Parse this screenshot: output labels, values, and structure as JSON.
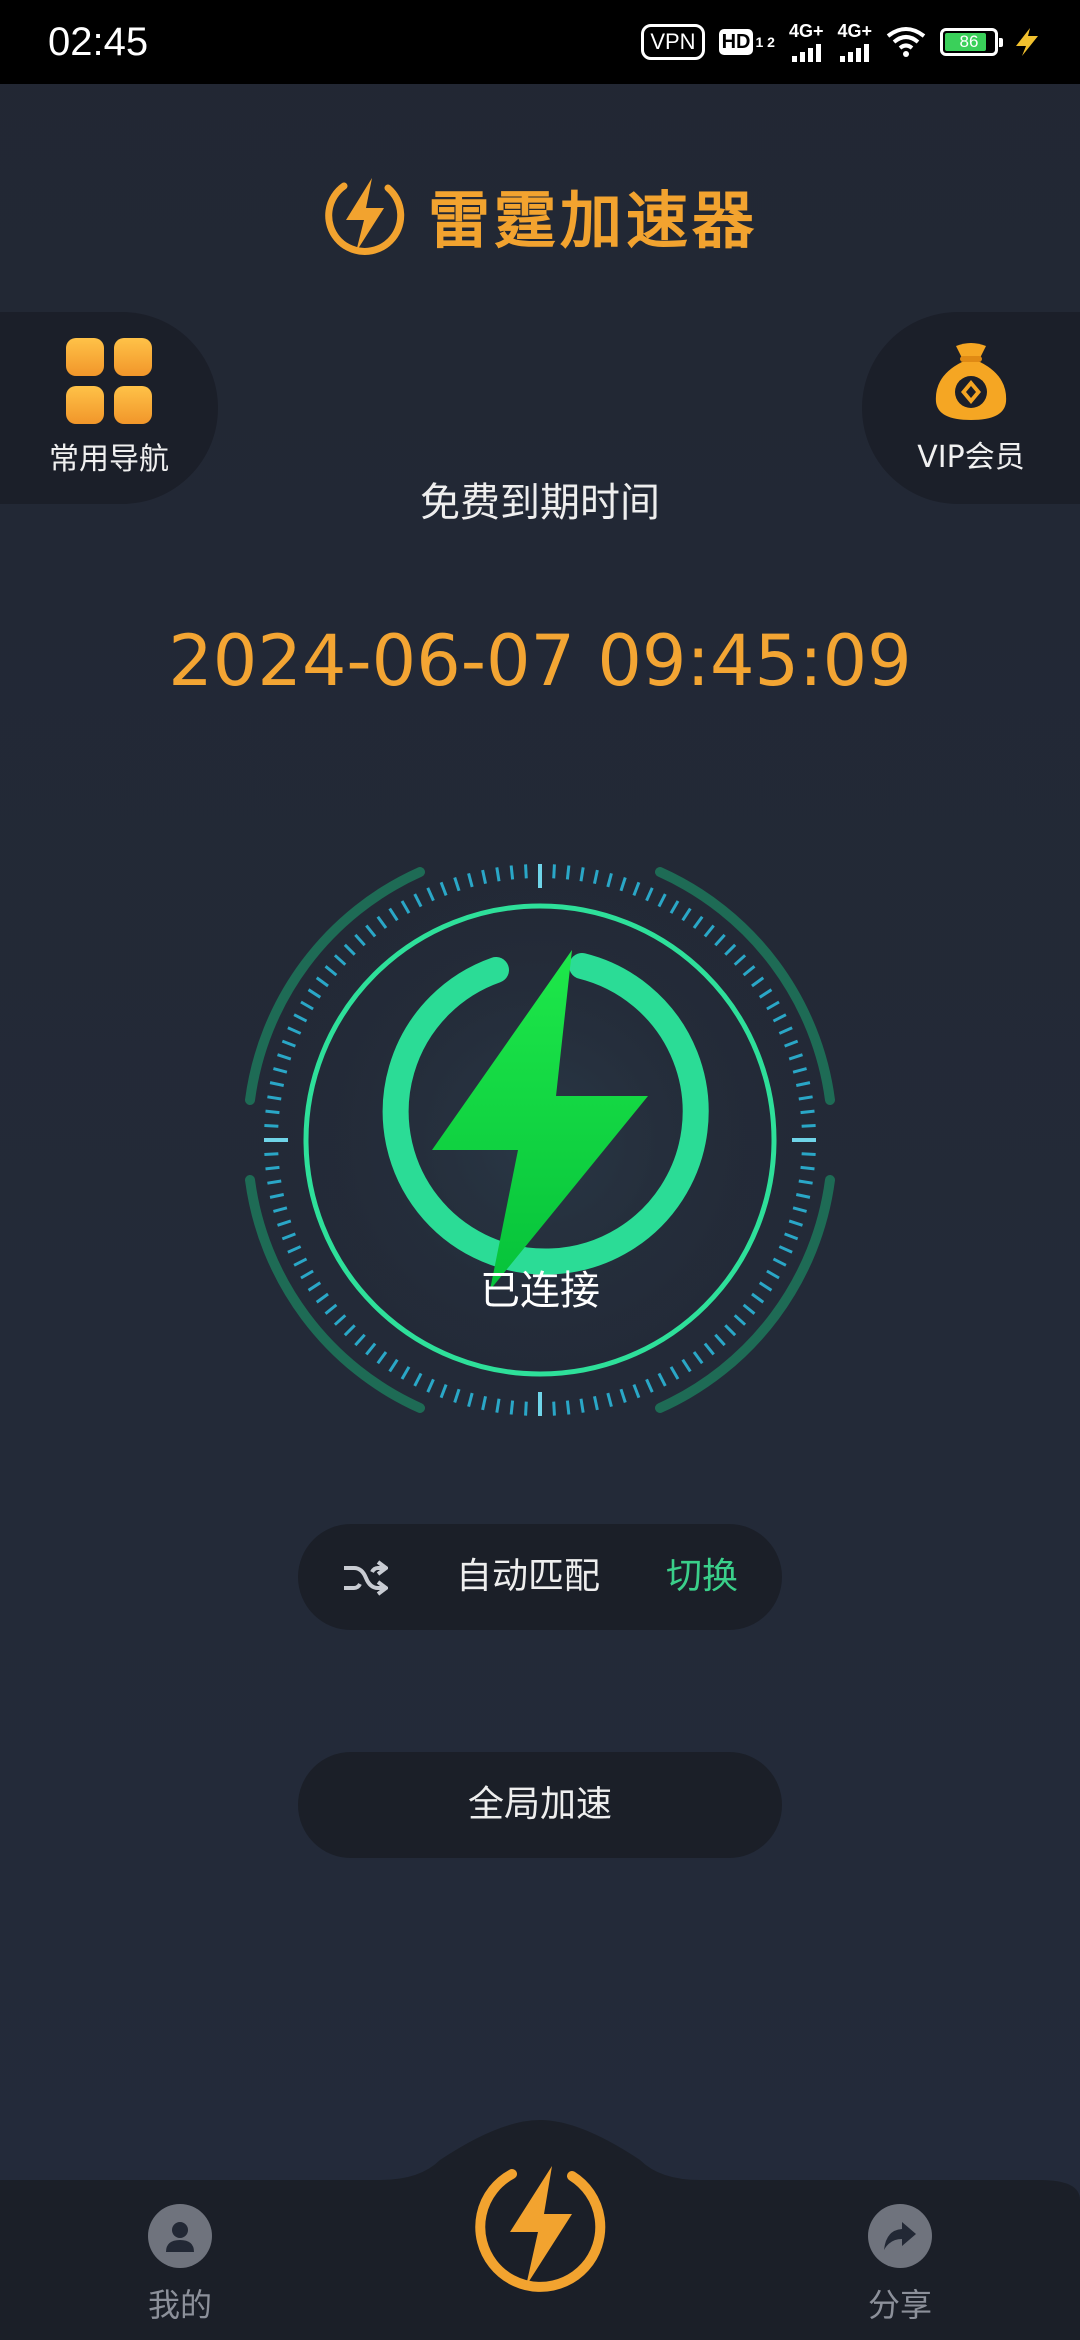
{
  "status_bar": {
    "time": "02:45",
    "vpn": "VPN",
    "hd": "HD",
    "hd_sub": "1 2",
    "net1": "4G+",
    "net2": "4G+",
    "battery": "86",
    "battery_level": 0.86
  },
  "header": {
    "title": "雷霆加速器",
    "logo_icon": "lightning-icon"
  },
  "side": {
    "nav_label": "常用导航",
    "vip_label": "VIP会员"
  },
  "expiry": {
    "label": "免费到期时间",
    "time": "2024-06-07 09:45:09"
  },
  "connection": {
    "status": "已连接"
  },
  "mode": {
    "label": "自动匹配",
    "switch_label": "切换",
    "icon": "shuffle-icon"
  },
  "global": {
    "label": "全局加速"
  },
  "bottom_nav": {
    "me_label": "我的",
    "share_label": "分享"
  },
  "colors": {
    "accent": "#f2a32f",
    "green": "#3ad08a",
    "background": "#222835"
  }
}
